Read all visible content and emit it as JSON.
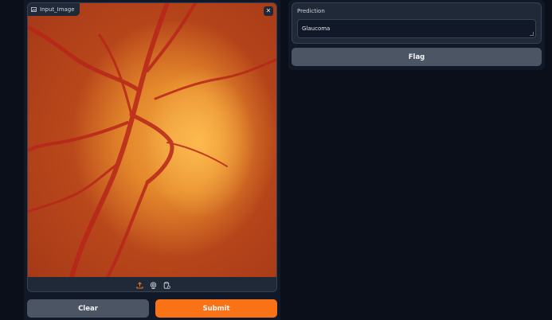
{
  "input": {
    "label": "Input_Image",
    "label_icon": "image-icon",
    "close_icon": "close-icon",
    "toolbar_icons": [
      "upload-icon",
      "webcam-icon",
      "clipboard-icon"
    ]
  },
  "actions": {
    "clear_label": "Clear",
    "submit_label": "Submit"
  },
  "output": {
    "prediction_label": "Prediction",
    "prediction_value": "Glaucoma",
    "flag_label": "Flag"
  },
  "colors": {
    "background": "#0b0f19",
    "panel": "#111827",
    "block": "#1f2937",
    "secondary_button": "#4b5563",
    "primary_button": "#f97316"
  }
}
